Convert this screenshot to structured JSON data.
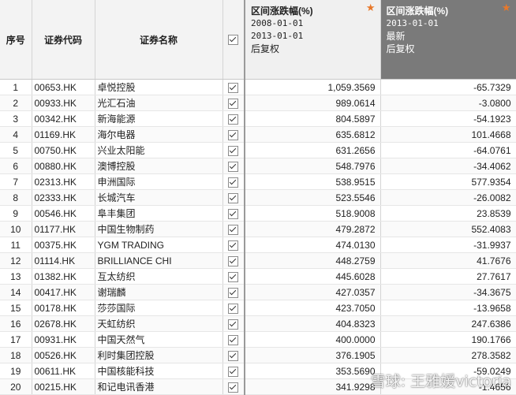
{
  "header": {
    "col_index": "序号",
    "col_code": "证券代码",
    "col_name": "证券名称",
    "col_a": {
      "title": "区间涨跌幅(%)",
      "line1": "2008-01-01",
      "line2": "2013-01-01",
      "line3": "后复权"
    },
    "col_b": {
      "title": "区间涨跌幅(%)",
      "line1": "2013-01-01",
      "line2": "最新",
      "line3": "后复权"
    }
  },
  "icons": {
    "star": "star-icon",
    "checkbox": "checkbox-checked-icon"
  },
  "colors": {
    "active_header_bg": "#7a7a7a",
    "star": "#e8782a"
  },
  "rows": [
    {
      "idx": "1",
      "code": "00653.HK",
      "name": "卓悦控股",
      "a": "1,059.3569",
      "b": "-65.7329"
    },
    {
      "idx": "2",
      "code": "00933.HK",
      "name": "光汇石油",
      "a": "989.0614",
      "b": "-3.0800"
    },
    {
      "idx": "3",
      "code": "00342.HK",
      "name": "新海能源",
      "a": "804.5897",
      "b": "-54.1923"
    },
    {
      "idx": "4",
      "code": "01169.HK",
      "name": "海尔电器",
      "a": "635.6812",
      "b": "101.4668"
    },
    {
      "idx": "5",
      "code": "00750.HK",
      "name": "兴业太阳能",
      "a": "631.2656",
      "b": "-64.0761"
    },
    {
      "idx": "6",
      "code": "00880.HK",
      "name": "澳博控股",
      "a": "548.7976",
      "b": "-34.4062"
    },
    {
      "idx": "7",
      "code": "02313.HK",
      "name": "申洲国际",
      "a": "538.9515",
      "b": "577.9354"
    },
    {
      "idx": "8",
      "code": "02333.HK",
      "name": "长城汽车",
      "a": "523.5546",
      "b": "-26.0082"
    },
    {
      "idx": "9",
      "code": "00546.HK",
      "name": "阜丰集团",
      "a": "518.9008",
      "b": "23.8539"
    },
    {
      "idx": "10",
      "code": "01177.HK",
      "name": "中国生物制药",
      "a": "479.2872",
      "b": "552.4083"
    },
    {
      "idx": "11",
      "code": "00375.HK",
      "name": "YGM TRADING",
      "a": "474.0130",
      "b": "-31.9937"
    },
    {
      "idx": "12",
      "code": "01114.HK",
      "name": "BRILLIANCE CHI",
      "a": "448.2759",
      "b": "41.7676"
    },
    {
      "idx": "13",
      "code": "01382.HK",
      "name": "互太纺织",
      "a": "445.6028",
      "b": "27.7617"
    },
    {
      "idx": "14",
      "code": "00417.HK",
      "name": "谢瑞麟",
      "a": "427.0357",
      "b": "-34.3675"
    },
    {
      "idx": "15",
      "code": "00178.HK",
      "name": "莎莎国际",
      "a": "423.7050",
      "b": "-13.9658"
    },
    {
      "idx": "16",
      "code": "02678.HK",
      "name": "天虹纺织",
      "a": "404.8323",
      "b": "247.6386"
    },
    {
      "idx": "17",
      "code": "00931.HK",
      "name": "中国天然气",
      "a": "400.0000",
      "b": "190.1766"
    },
    {
      "idx": "18",
      "code": "00526.HK",
      "name": "利时集团控股",
      "a": "376.1905",
      "b": "278.3582"
    },
    {
      "idx": "19",
      "code": "00611.HK",
      "name": "中国核能科技",
      "a": "353.5690",
      "b": "-59.0249"
    },
    {
      "idx": "20",
      "code": "00215.HK",
      "name": "和记电讯香港",
      "a": "341.9298",
      "b": "-1.4656"
    }
  ],
  "watermark": "雪球: 王雅媛victoria"
}
